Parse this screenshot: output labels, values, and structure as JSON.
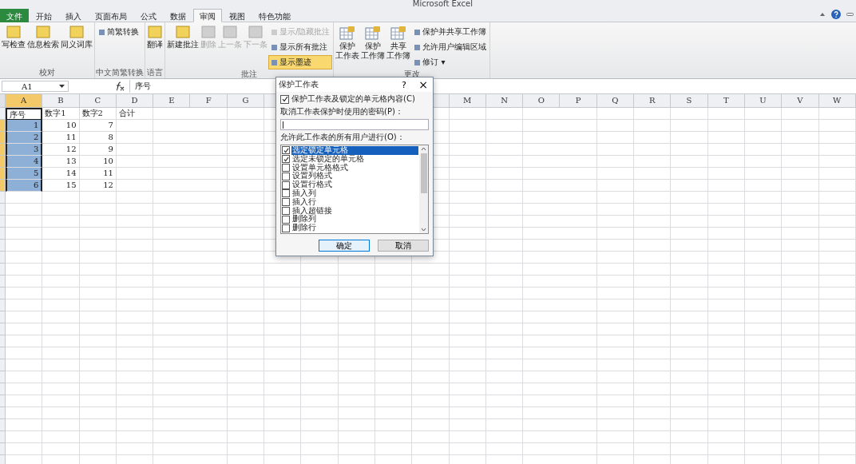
{
  "window": {
    "title": "Microsoft Excel"
  },
  "tabs": [
    {
      "label": "文件",
      "kind": "file",
      "selected": false
    },
    {
      "label": "开始",
      "kind": "tab",
      "selected": false
    },
    {
      "label": "插入",
      "kind": "tab",
      "selected": false
    },
    {
      "label": "页面布局",
      "kind": "tab",
      "selected": false
    },
    {
      "label": "公式",
      "kind": "tab",
      "selected": false
    },
    {
      "label": "数据",
      "kind": "tab",
      "selected": false
    },
    {
      "label": "审阅",
      "kind": "tab",
      "selected": true
    },
    {
      "label": "视图",
      "kind": "tab",
      "selected": false
    },
    {
      "label": "特色功能",
      "kind": "tab",
      "selected": false
    }
  ],
  "ribbon": {
    "groups": [
      {
        "label": "校对",
        "large": [
          {
            "lines": [
              "写检查"
            ],
            "disabled": false
          },
          {
            "lines": [
              "信息检索"
            ],
            "disabled": false
          },
          {
            "lines": [
              "同义词库"
            ],
            "disabled": false
          }
        ]
      },
      {
        "label": "中文简繁转换",
        "small": [
          {
            "label": "简繁转换",
            "disabled": false,
            "active": false
          }
        ]
      },
      {
        "label": "语言",
        "large": [
          {
            "lines": [
              "翻译"
            ],
            "disabled": false
          }
        ]
      },
      {
        "label": "批注",
        "large": [
          {
            "lines": [
              "新建批注"
            ],
            "disabled": false
          },
          {
            "lines": [
              "删除"
            ],
            "disabled": true
          },
          {
            "lines": [
              "上一条"
            ],
            "disabled": true
          },
          {
            "lines": [
              "下一条"
            ],
            "disabled": true
          }
        ],
        "small": [
          {
            "label": "显示/隐藏批注",
            "disabled": true,
            "active": false
          },
          {
            "label": "显示所有批注",
            "disabled": false,
            "active": false
          },
          {
            "label": "显示墨迹",
            "disabled": false,
            "active": true
          }
        ]
      },
      {
        "label": "更改",
        "large": [
          {
            "lines": [
              "保护",
              "工作表"
            ],
            "disabled": false
          },
          {
            "lines": [
              "保护",
              "工作簿"
            ],
            "disabled": false
          },
          {
            "lines": [
              "共享",
              "工作簿"
            ],
            "disabled": false
          }
        ],
        "small": [
          {
            "label": "保护并共享工作簿",
            "disabled": false,
            "active": false
          },
          {
            "label": "允许用户编辑区域",
            "disabled": false,
            "active": false
          },
          {
            "label": "修订 ▾",
            "disabled": false,
            "active": false
          }
        ]
      }
    ]
  },
  "formula_bar": {
    "name_box": "A1",
    "content": "序号"
  },
  "sheet": {
    "columns_left": [
      {
        "letter": "A",
        "selected": true
      },
      {
        "letter": "B",
        "selected": false
      },
      {
        "letter": "C",
        "selected": false
      },
      {
        "letter": "D",
        "selected": false
      },
      {
        "letter": "E",
        "selected": false
      },
      {
        "letter": "F",
        "selected": false
      },
      {
        "letter": "G",
        "selected": false
      }
    ],
    "columns_right": [
      {
        "letter": "M",
        "selected": false
      },
      {
        "letter": "N",
        "selected": false
      },
      {
        "letter": "O",
        "selected": false
      },
      {
        "letter": "P",
        "selected": false
      },
      {
        "letter": "Q",
        "selected": false
      },
      {
        "letter": "R",
        "selected": false
      },
      {
        "letter": "S",
        "selected": false
      },
      {
        "letter": "T",
        "selected": false
      },
      {
        "letter": "U",
        "selected": false
      },
      {
        "letter": "V",
        "selected": false
      },
      {
        "letter": "W",
        "selected": false
      }
    ],
    "rows": [
      {
        "selected": false,
        "cells": [
          "序号",
          "数字1",
          "数字2",
          "合计"
        ]
      },
      {
        "selected": true,
        "cells": [
          "1",
          "10",
          "7"
        ]
      },
      {
        "selected": true,
        "cells": [
          "2",
          "11",
          "8"
        ]
      },
      {
        "selected": true,
        "cells": [
          "3",
          "12",
          "9"
        ]
      },
      {
        "selected": true,
        "cells": [
          "4",
          "13",
          "10"
        ]
      },
      {
        "selected": true,
        "cells": [
          "5",
          "14",
          "11"
        ]
      },
      {
        "selected": true,
        "cells": [
          "6",
          "15",
          "12"
        ]
      }
    ]
  },
  "dialog": {
    "title": "保护工作表",
    "help": "?",
    "close": "×",
    "protect": {
      "label": "保护工作表及锁定的单元格内容(C)",
      "checked": true
    },
    "password_label": "取消工作表保护时使用的密码(P)：",
    "allow_label": "允许此工作表的所有用户进行(O)：",
    "options": [
      {
        "label": "选定锁定单元格",
        "checked": true,
        "selected": true
      },
      {
        "label": "选定未锁定的单元格",
        "checked": true,
        "selected": false
      },
      {
        "label": "设置单元格格式",
        "checked": false,
        "selected": false
      },
      {
        "label": "设置列格式",
        "checked": false,
        "selected": false
      },
      {
        "label": "设置行格式",
        "checked": false,
        "selected": false
      },
      {
        "label": "插入列",
        "checked": false,
        "selected": false
      },
      {
        "label": "插入行",
        "checked": false,
        "selected": false
      },
      {
        "label": "插入超链接",
        "checked": false,
        "selected": false
      },
      {
        "label": "删除列",
        "checked": false,
        "selected": false
      },
      {
        "label": "删除行",
        "checked": false,
        "selected": false
      }
    ],
    "buttons": [
      {
        "label": "确定",
        "kind": "default"
      },
      {
        "label": "取消",
        "kind": "normal"
      }
    ]
  }
}
